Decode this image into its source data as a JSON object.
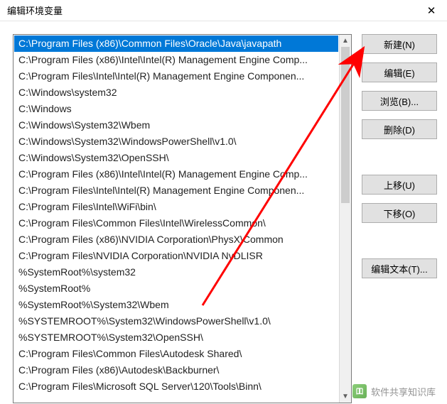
{
  "window": {
    "title": "编辑环境变量",
    "close_glyph": "✕"
  },
  "list": {
    "items": [
      "C:\\Program Files (x86)\\Common Files\\Oracle\\Java\\javapath",
      "C:\\Program Files (x86)\\Intel\\Intel(R) Management Engine Comp...",
      "C:\\Program Files\\Intel\\Intel(R) Management Engine Componen...",
      "C:\\Windows\\system32",
      "C:\\Windows",
      "C:\\Windows\\System32\\Wbem",
      "C:\\Windows\\System32\\WindowsPowerShell\\v1.0\\",
      "C:\\Windows\\System32\\OpenSSH\\",
      "C:\\Program Files (x86)\\Intel\\Intel(R) Management Engine Comp...",
      "C:\\Program Files\\Intel\\Intel(R) Management Engine Componen...",
      "C:\\Program Files\\Intel\\WiFi\\bin\\",
      "C:\\Program Files\\Common Files\\Intel\\WirelessCommon\\",
      "C:\\Program Files (x86)\\NVIDIA Corporation\\PhysX\\Common",
      "C:\\Program Files\\NVIDIA Corporation\\NVIDIA NvDLISR",
      "%SystemRoot%\\system32",
      "%SystemRoot%",
      "%SystemRoot%\\System32\\Wbem",
      "%SYSTEMROOT%\\System32\\WindowsPowerShell\\v1.0\\",
      "%SYSTEMROOT%\\System32\\OpenSSH\\",
      "C:\\Program Files\\Common Files\\Autodesk Shared\\",
      "C:\\Program Files (x86)\\Autodesk\\Backburner\\",
      "C:\\Program Files\\Microsoft SQL Server\\120\\Tools\\Binn\\"
    ],
    "selected_index": 0
  },
  "buttons": {
    "new": "新建(N)",
    "edit": "编辑(E)",
    "browse": "浏览(B)...",
    "delete": "删除(D)",
    "moveup": "上移(U)",
    "movedown": "下移(O)",
    "edittext": "编辑文本(T)..."
  },
  "scrollbar": {
    "up_glyph": "▲",
    "down_glyph": "▼"
  },
  "watermark": {
    "text": "软件共享知识库"
  }
}
